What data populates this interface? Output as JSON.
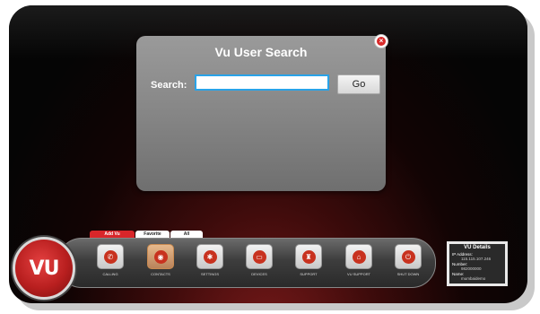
{
  "dialog": {
    "title": "Vu User Search",
    "search_label": "Search:",
    "search_value": "",
    "search_placeholder": "",
    "go_label": "Go",
    "close_icon": "close-icon"
  },
  "tabs": [
    {
      "label": "Add Vu Contacts"
    },
    {
      "label": "Favorite"
    },
    {
      "label": "All"
    }
  ],
  "logo": {
    "text": "VU"
  },
  "apps": [
    {
      "label": "CALLING",
      "icon": "phone-icon",
      "glyph": "✆"
    },
    {
      "label": "CONTACTS",
      "icon": "contacts-icon",
      "glyph": "◉"
    },
    {
      "label": "SETTINGS",
      "icon": "settings-icon",
      "glyph": "✱"
    },
    {
      "label": "DEVICES",
      "icon": "devices-icon",
      "glyph": "▭"
    },
    {
      "label": "SUPPORT",
      "icon": "support-icon",
      "glyph": "♜"
    },
    {
      "label": "VU SUPPORT",
      "icon": "home-icon",
      "glyph": "⌂"
    },
    {
      "label": "SHUT DOWN",
      "icon": "power-icon",
      "glyph": "⏻"
    }
  ],
  "details": {
    "title": "VU Details",
    "ip_label": "IP Address:",
    "ip_value": "115.115.107.246",
    "number_label": "Number:",
    "number_value": "982000000",
    "name_label": "Name:",
    "name_value": "mumbaidemo"
  },
  "colors": {
    "accent": "#d8262a",
    "input_border": "#29a3e8"
  }
}
